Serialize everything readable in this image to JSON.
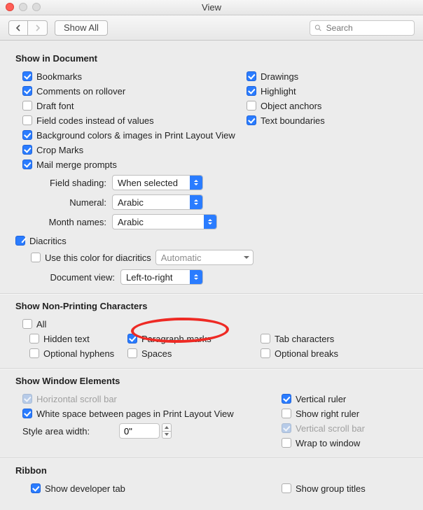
{
  "window": {
    "title": "View"
  },
  "toolbar": {
    "show_all_label": "Show All",
    "search_placeholder": "Search"
  },
  "sections": {
    "show_in_doc": {
      "title": "Show in Document",
      "left": {
        "bookmarks": "Bookmarks",
        "comments": "Comments on rollover",
        "draft_font": "Draft font",
        "field_codes": "Field codes instead of values",
        "bg_colors": "Background colors & images in Print Layout View",
        "crop_marks": "Crop Marks",
        "mail_merge": "Mail merge prompts"
      },
      "right": {
        "drawings": "Drawings",
        "highlight": "Highlight",
        "object_anchors": "Object anchors",
        "text_boundaries": "Text boundaries"
      },
      "form": {
        "field_shading_label": "Field shading:",
        "field_shading_value": "When selected",
        "numeral_label": "Numeral:",
        "numeral_value": "Arabic",
        "month_names_label": "Month names:",
        "month_names_value": "Arabic"
      },
      "diacritics": {
        "label": "Diacritics",
        "use_color": "Use this color for diacritics",
        "color_value": "Automatic"
      },
      "doc_view": {
        "label": "Document view:",
        "value": "Left-to-right"
      }
    },
    "nonprinting": {
      "title": "Show Non-Printing Characters",
      "all": "All",
      "hidden_text": "Hidden text",
      "optional_hyphens": "Optional hyphens",
      "paragraph_marks": "Paragraph marks",
      "spaces": "Spaces",
      "tab_chars": "Tab characters",
      "optional_breaks": "Optional breaks"
    },
    "win_elements": {
      "title": "Show Window Elements",
      "h_scroll": "Horizontal scroll bar",
      "white_space": "White space between pages in Print Layout View",
      "style_area_label": "Style area width:",
      "style_area_value": "0\"",
      "v_ruler": "Vertical ruler",
      "show_right_ruler": "Show right ruler",
      "v_scroll": "Vertical scroll bar",
      "wrap": "Wrap to window"
    },
    "ribbon": {
      "title": "Ribbon",
      "dev_tab": "Show developer tab",
      "group_titles": "Show group titles"
    }
  }
}
